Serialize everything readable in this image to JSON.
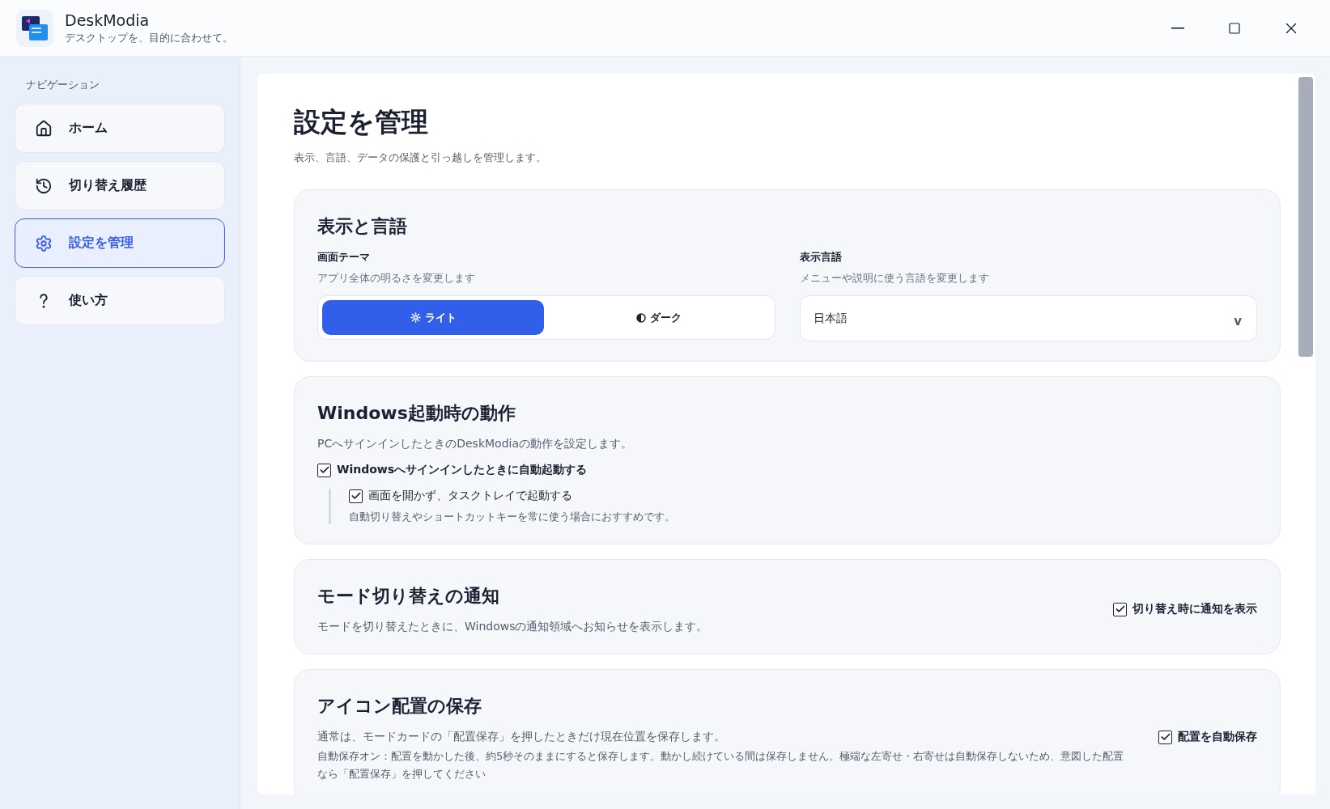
{
  "app": {
    "name": "DeskModia",
    "tagline": "デスクトップを、目的に合わせて。"
  },
  "sidebar": {
    "heading": "ナビゲーション",
    "items": [
      {
        "label": "ホーム",
        "kind": "home",
        "selected": false
      },
      {
        "label": "切り替え履歴",
        "kind": "history",
        "selected": false
      },
      {
        "label": "設定を管理",
        "kind": "settings",
        "selected": true
      },
      {
        "label": "使い方",
        "kind": "help",
        "selected": false
      }
    ]
  },
  "page": {
    "title": "設定を管理",
    "subtitle": "表示、言語、データの保護と引っ越しを管理します。"
  },
  "display_card": {
    "title": "表示と言語",
    "theme": {
      "label": "画面テーマ",
      "hint": "アプリ全体の明るさを変更します",
      "options": [
        {
          "label": "ライト",
          "kind": "light",
          "selected": true
        },
        {
          "label": "ダーク",
          "kind": "dark",
          "selected": false
        }
      ]
    },
    "language": {
      "label": "表示言語",
      "hint": "メニューや説明に使う言語を変更します",
      "value": "日本語",
      "caret": "v"
    }
  },
  "startup_card": {
    "title": "Windows起動時の動作",
    "description": "PCへサインインしたときのDeskModiaの動作を設定します。",
    "autostart": {
      "label": "Windowsへサインインしたときに自動起動する",
      "checked": true
    },
    "tray": {
      "label": "画面を開かず、タスクトレイで起動する",
      "checked": true,
      "hint": "自動切り替えやショートカットキーを常に使う場合におすすめです。"
    }
  },
  "notify_card": {
    "title": "モード切り替えの通知",
    "description": "モードを切り替えたときに、Windowsの通知領域へお知らせを表示します。",
    "option": {
      "label": "切り替え時に通知を表示",
      "checked": true
    }
  },
  "layout_card": {
    "title": "アイコン配置の保存",
    "description": "通常は、モードカードの「配置保存」を押したときだけ現在位置を保存します。",
    "detail": "自動保存オン：配置を動かした後、約5秒そのままにすると保存します。動かし続けている間は保存しません。極端な左寄せ・右寄せは自動保存しないため、意図した配置なら「配置保存」を押してください",
    "option": {
      "label": "配置を自動保存",
      "checked": true
    }
  }
}
